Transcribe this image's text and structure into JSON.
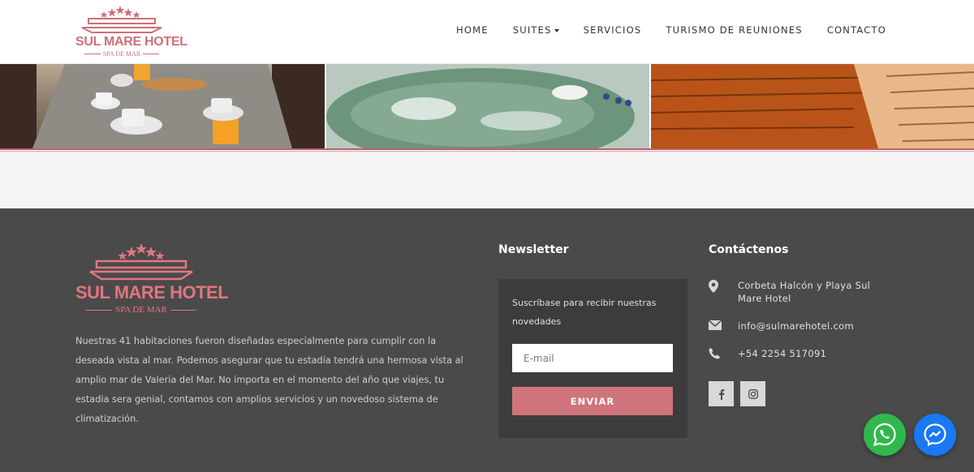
{
  "brand": {
    "name": "SUL MARE HOTEL",
    "tagline": "SPA DE MAR",
    "accent_color": "#cf6f78"
  },
  "nav": {
    "items": [
      {
        "label": "HOME",
        "has_dropdown": false
      },
      {
        "label": "SUITES",
        "has_dropdown": true
      },
      {
        "label": "SERVICIOS",
        "has_dropdown": false
      },
      {
        "label": "TURISMO DE REUNIONES",
        "has_dropdown": false
      },
      {
        "label": "CONTACTO",
        "has_dropdown": false
      }
    ]
  },
  "gallery": {
    "images": [
      "breakfast-table-photo",
      "jacuzzi-photo",
      "sauna-photo"
    ]
  },
  "footer": {
    "about": "Nuestras 41 habitaciones fueron diseñadas especialmente para cumplir con la deseada vista al mar. Podemos asegurar que tu estadía tendrá una hermosa vista al amplio mar de Valeria del Mar. No importa en el momento del año que viajes, tu estadia sera genial, contamos con amplios servicios y un novedoso sistema de climatización.",
    "newsletter": {
      "title": "Newsletter",
      "text": "Suscríbase para recibir nuestras novedades",
      "email_value": "",
      "email_placeholder": "E-mail",
      "button_label": "ENVIAR"
    },
    "contact": {
      "title": "Contáctenos",
      "address": "Corbeta Halcón y Playa Sul Mare Hotel",
      "email": "info@sulmarehotel.com",
      "phone": "+54 2254 517091"
    },
    "social": [
      "facebook-icon",
      "instagram-icon"
    ]
  },
  "floating_buttons": [
    "whatsapp-icon",
    "messenger-icon"
  ]
}
